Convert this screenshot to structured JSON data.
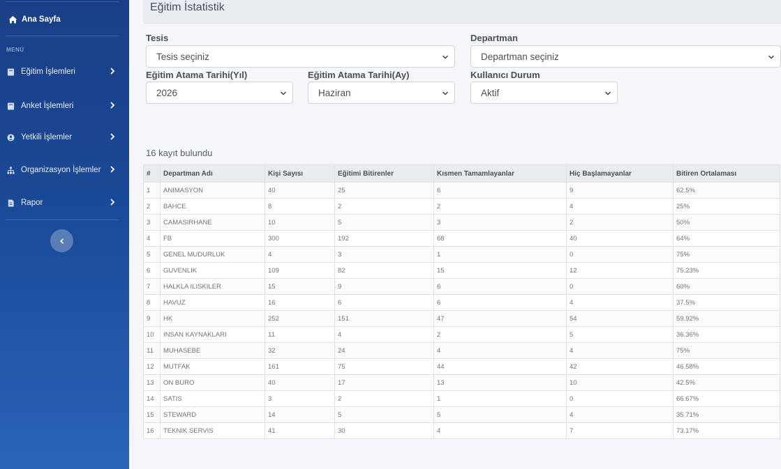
{
  "sidebar": {
    "home_label": "Ana Sayfa",
    "menu_header": "MENÜ",
    "items": [
      {
        "label": "Eğitim İşlemleri",
        "icon": "book-icon"
      },
      {
        "label": "Anket İşlemleri",
        "icon": "book-icon"
      },
      {
        "label": "Yetkili İşlemler",
        "icon": "user-circle-icon"
      },
      {
        "label": "Organizasyon İşlemler",
        "icon": "sitemap-icon"
      },
      {
        "label": "Rapor",
        "icon": "file-icon"
      }
    ]
  },
  "page": {
    "title": "Eğitim İstatistik"
  },
  "filters": {
    "tesis": {
      "label": "Tesis",
      "value": "Tesis seçiniz"
    },
    "departman": {
      "label": "Departman",
      "value": "Departman seçiniz"
    },
    "yil": {
      "label": "Eğitim Atama Tarihi(Yıl)",
      "value": "2026"
    },
    "ay": {
      "label": "Eğitim Atama Tarihi(Ay)",
      "value": "Haziran"
    },
    "durum": {
      "label": "Kullanıcı Durum",
      "value": "Aktif"
    }
  },
  "result_count": "16 kayıt bulundu",
  "table": {
    "headers": [
      "#",
      "Departman Adı",
      "Kişi Sayısı",
      "Eğitimi Bitirenler",
      "Kısmen Tamamlayanlar",
      "Hiç Başlamayanlar",
      "Bitiren Ortalaması"
    ],
    "rows": [
      [
        "1",
        "ANIMASYON",
        "40",
        "25",
        "6",
        "9",
        "62.5%"
      ],
      [
        "2",
        "BAHCE",
        "8",
        "2",
        "2",
        "4",
        "25%"
      ],
      [
        "3",
        "CAMASIRHANE",
        "10",
        "5",
        "3",
        "2",
        "50%"
      ],
      [
        "4",
        "FB",
        "300",
        "192",
        "68",
        "40",
        "64%"
      ],
      [
        "5",
        "GENEL MUDURLUK",
        "4",
        "3",
        "1",
        "0",
        "75%"
      ],
      [
        "6",
        "GUVENLIK",
        "109",
        "82",
        "15",
        "12",
        "75.23%"
      ],
      [
        "7",
        "HALKLA ILISKILER",
        "15",
        "9",
        "6",
        "0",
        "60%"
      ],
      [
        "8",
        "HAVUZ",
        "16",
        "6",
        "6",
        "4",
        "37.5%"
      ],
      [
        "9",
        "HK",
        "252",
        "151",
        "47",
        "54",
        "59.92%"
      ],
      [
        "10",
        "INSAN KAYNAKLARI",
        "11",
        "4",
        "2",
        "5",
        "36.36%"
      ],
      [
        "11",
        "MUHASEBE",
        "32",
        "24",
        "4",
        "4",
        "75%"
      ],
      [
        "12",
        "MUTFAK",
        "161",
        "75",
        "44",
        "42",
        "46.58%"
      ],
      [
        "13",
        "ON BURO",
        "40",
        "17",
        "13",
        "10",
        "42.5%"
      ],
      [
        "14",
        "SATIS",
        "3",
        "2",
        "1",
        "0",
        "66.67%"
      ],
      [
        "15",
        "STEWARD",
        "14",
        "5",
        "5",
        "4",
        "35.71%"
      ],
      [
        "16",
        "TEKNIK SERVIS",
        "41",
        "30",
        "4",
        "7",
        "73.17%"
      ]
    ]
  }
}
